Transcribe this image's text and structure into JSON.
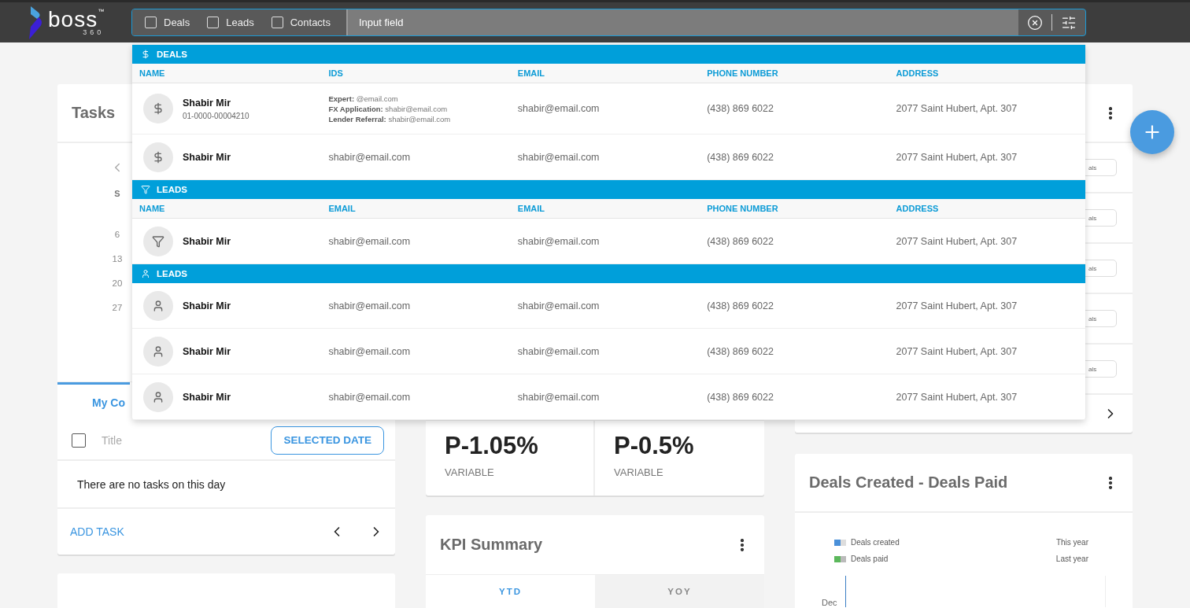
{
  "logo": {
    "name": "boss",
    "mark": "™",
    "sub": "360"
  },
  "search": {
    "filters": [
      {
        "label": "Deals",
        "checked": false
      },
      {
        "label": "Leads",
        "checked": false
      },
      {
        "label": "Contacts",
        "checked": false
      }
    ],
    "value": "Input field"
  },
  "results": [
    {
      "kind": "deal",
      "title": "DEALS",
      "name_heading": "NAME",
      "columns": [
        "IDS",
        "EMAIL",
        "PHONE NUMBER",
        "ADDRESS"
      ],
      "rows": [
        {
          "name": "Shabir Mir",
          "subtitle": "01-0000-00004210",
          "cells": [
            [
              "**Expert:** @email.com",
              "**FX Application:** shabir@email.com",
              "**Lender Referral:** shabir@email.com"
            ],
            "shabir@email.com",
            "(438) 869 6022",
            "2077 Saint Hubert, Apt. 307"
          ]
        },
        {
          "name": "Shabir Mir",
          "cells": [
            "shabir@email.com",
            "shabir@email.com",
            "(438) 869 6022",
            "2077 Saint Hubert, Apt. 307"
          ]
        }
      ]
    },
    {
      "kind": "lead",
      "title": "LEADS",
      "name_heading": "NAME",
      "columns": [
        "EMAIL",
        "EMAIL",
        "PHONE NUMBER",
        "ADDRESS"
      ],
      "rows": [
        {
          "name": "Shabir Mir",
          "cells": [
            "shabir@email.com",
            "shabir@email.com",
            "(438) 869 6022",
            "2077 Saint Hubert, Apt. 307"
          ]
        }
      ]
    },
    {
      "kind": "contact",
      "title": "LEADS",
      "rows": [
        {
          "name": "Shabir Mir",
          "cells": [
            "shabir@email.com",
            "shabir@email.com",
            "(438) 869 6022",
            "2077 Saint Hubert, Apt. 307"
          ]
        },
        {
          "name": "Shabir Mir",
          "cells": [
            "shabir@email.com",
            "shabir@email.com",
            "(438) 869 6022",
            "2077 Saint Hubert, Apt. 307"
          ]
        },
        {
          "name": "Shabir Mir",
          "cells": [
            "shabir@email.com",
            "shabir@email.com",
            "(438) 869 6022",
            "2077 Saint Hubert, Apt. 307"
          ]
        }
      ]
    }
  ],
  "tasks": {
    "title": "Tasks",
    "calendar": {
      "weekday": "S",
      "days": [
        "6",
        "13",
        "20",
        "27"
      ]
    },
    "tabs": [
      {
        "label": "My Co",
        "selected": true
      }
    ],
    "new_task": {
      "placeholder": "Title",
      "checked": false,
      "date_button": "SELECTED DATE"
    },
    "empty": "There are no tasks on this day",
    "add_button": "ADD TASK"
  },
  "stats": [
    {
      "value": "P-1.05%",
      "label": "VARIABLE"
    },
    {
      "value": "P-0.5%",
      "label": "VARIABLE"
    }
  ],
  "kpi": {
    "title": "KPI Summary",
    "tabs": [
      {
        "label": "YTD",
        "selected": true
      },
      {
        "label": "YOY",
        "selected": false
      }
    ]
  },
  "pipeline": {
    "chips": [
      "als",
      "als",
      "als",
      "als",
      "als"
    ]
  },
  "deals_chart": {
    "title": "Deals Created - Deals Paid",
    "legend": [
      {
        "label": "Deals created",
        "period": "This year",
        "color": "#4a90d9"
      },
      {
        "label": "Deals paid",
        "period": "Last year",
        "color": "#5cb85c"
      }
    ],
    "axis_label": "Dec"
  }
}
